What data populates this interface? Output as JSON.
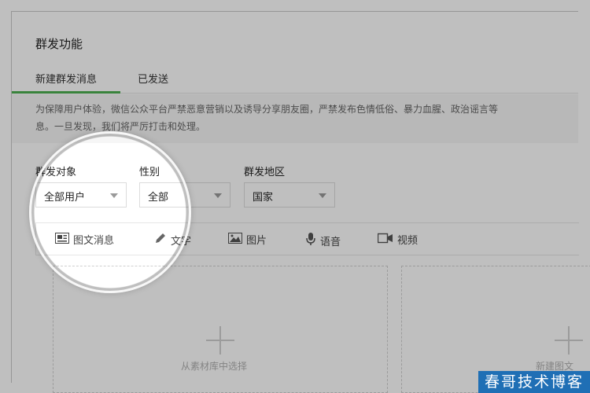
{
  "page": {
    "title": "群发功能"
  },
  "tabs": [
    {
      "label": "新建群发消息",
      "active": true
    },
    {
      "label": "已发送",
      "active": false
    }
  ],
  "notice": {
    "line1": "为保障用户体验，微信公众平台严禁恶意营销以及诱导分享朋友圈，严禁发布色情低俗、暴力血腥、政治谣言等",
    "line2": "息。一旦发现，我们将严厉打击和处理。"
  },
  "filters": {
    "target": {
      "label": "群发对象",
      "value": "全部用户"
    },
    "gender": {
      "label": "性别",
      "value": "全部"
    },
    "region": {
      "label": "群发地区",
      "value": "国家"
    }
  },
  "toolbar": {
    "items": [
      {
        "label": "图文消息",
        "icon": "news-icon"
      },
      {
        "label": "文字",
        "icon": "pencil-icon"
      },
      {
        "label": "图片",
        "icon": "image-icon"
      },
      {
        "label": "语音",
        "icon": "microphone-icon"
      },
      {
        "label": "视频",
        "icon": "video-camera-icon"
      }
    ]
  },
  "cards": {
    "library": {
      "label": "从素材库中选择"
    },
    "create": {
      "label": "新建图文"
    }
  },
  "watermark": {
    "text": "春哥技术博客"
  },
  "colors": {
    "accent": "#4caf50",
    "watermark_bg": "#1f6fb5"
  }
}
